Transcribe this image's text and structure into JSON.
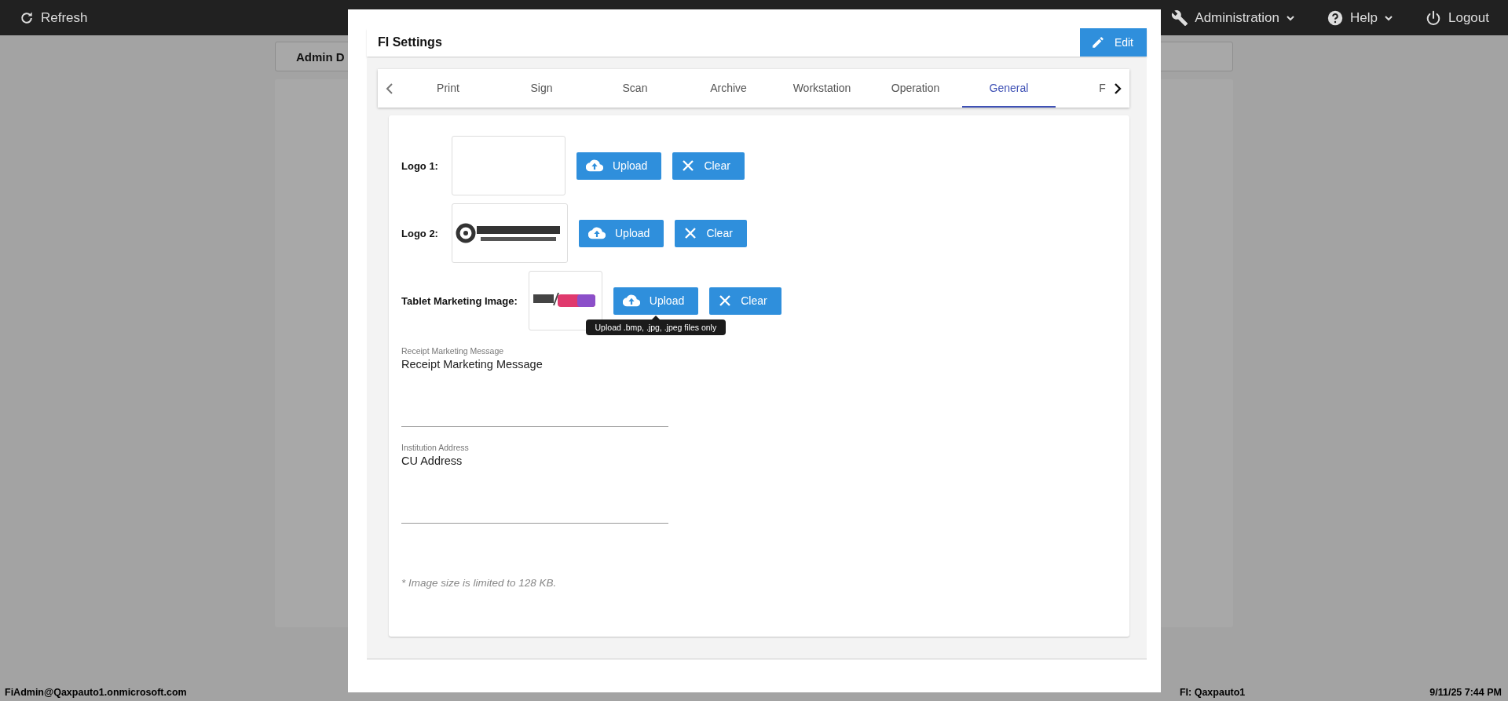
{
  "top_bar": {
    "refresh": "Refresh",
    "menus": [
      {
        "label": "Administration",
        "dropdown": true
      },
      {
        "label": "Help",
        "dropdown": true
      },
      {
        "label": "Logout",
        "dropdown": false
      }
    ]
  },
  "background_card": {
    "title": "Admin D"
  },
  "dialog": {
    "title": "FI Settings",
    "edit_button": "Edit",
    "tabs": [
      {
        "label": "Print",
        "selected": false
      },
      {
        "label": "Sign",
        "selected": false
      },
      {
        "label": "Scan",
        "selected": false
      },
      {
        "label": "Archive",
        "selected": false
      },
      {
        "label": "Workstation",
        "selected": false
      },
      {
        "label": "Operation",
        "selected": false
      },
      {
        "label": "General",
        "selected": true
      },
      {
        "label": "F",
        "selected": false
      }
    ],
    "image_rows": [
      {
        "label": "Logo 1:",
        "image": {
          "kind": "empty"
        },
        "upload": "Upload",
        "clear": "Clear"
      },
      {
        "label": "Logo 2:",
        "upload": "Upload",
        "clear": "Clear"
      },
      {
        "label": "Tablet Marketing Image:",
        "upload": "Upload",
        "clear": "Clear",
        "tooltip": "Upload .bmp, .jpg, .jpeg files only"
      }
    ],
    "text_fields": [
      {
        "label": "Receipt Marketing Message",
        "value": "Receipt Marketing Message"
      },
      {
        "label": "Institution Address",
        "value": "CU Address"
      }
    ],
    "note": "* Image size is limited to 128 KB."
  },
  "status_bar": {
    "user": "FiAdmin@Qaxpauto1.onmicrosoft.com",
    "fi": "FI: Qaxpauto1",
    "datetime": "9/11/25 7:44 PM"
  }
}
